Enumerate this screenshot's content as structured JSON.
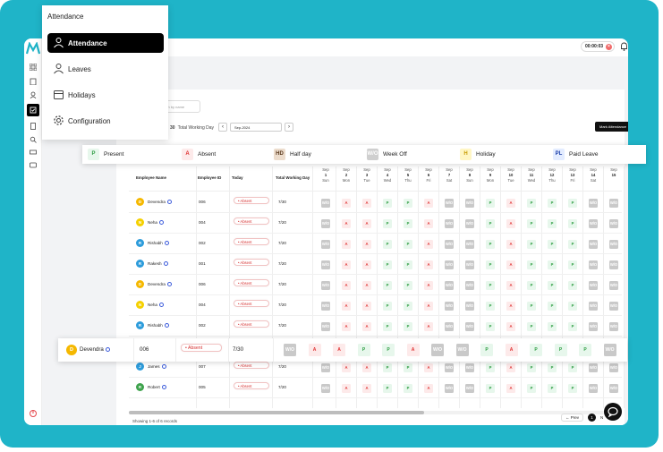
{
  "menu": {
    "title": "Attendance",
    "items": [
      {
        "label": "Attendance",
        "icon": "attendance-icon",
        "active": true
      },
      {
        "label": "Leaves",
        "icon": "leaves-icon",
        "active": false
      },
      {
        "label": "Holidays",
        "icon": "calendar-icon",
        "active": false
      },
      {
        "label": "Configuration",
        "icon": "gear-icon",
        "active": false
      }
    ]
  },
  "header": {
    "timer": "00:00:03"
  },
  "toolbar": {
    "search_placeholder": "Search by name",
    "working_days_count": "30",
    "working_days_label": "Total Working Day",
    "month": "Sep-2024",
    "mark_attendance": "Mark Attendance"
  },
  "legend": [
    {
      "code": "P",
      "label": "Present",
      "bg": "#e7f7ec",
      "fg": "#2f9e44"
    },
    {
      "code": "A",
      "label": "Absent",
      "bg": "#fdeaea",
      "fg": "#e03131"
    },
    {
      "code": "HD",
      "label": "Half day",
      "bg": "#ecdccc",
      "fg": "#5b3a1e"
    },
    {
      "code": "W/O",
      "label": "Week Off",
      "bg": "#cfcfcf",
      "fg": "#ffffff"
    },
    {
      "code": "H",
      "label": "Holiday",
      "bg": "#fff6c4",
      "fg": "#c79a00"
    },
    {
      "code": "PL",
      "label": "Paid Leave",
      "bg": "#e3ecff",
      "fg": "#1c3faa"
    }
  ],
  "table": {
    "columns": {
      "name": "Employee Name",
      "id": "Employee ID",
      "today": "Today",
      "total": "Total Working Day"
    },
    "days": [
      {
        "m": "Sep",
        "d": "1",
        "w": "Sun"
      },
      {
        "m": "Sep",
        "d": "2",
        "w": "Mon"
      },
      {
        "m": "Sep",
        "d": "3",
        "w": "Tue"
      },
      {
        "m": "Sep",
        "d": "4",
        "w": "Wed"
      },
      {
        "m": "Sep",
        "d": "5",
        "w": "Thu"
      },
      {
        "m": "Sep",
        "d": "6",
        "w": "Fri"
      },
      {
        "m": "Sep",
        "d": "7",
        "w": "Sat"
      },
      {
        "m": "Sep",
        "d": "8",
        "w": "Sun"
      },
      {
        "m": "Sep",
        "d": "9",
        "w": "Mon"
      },
      {
        "m": "Sep",
        "d": "10",
        "w": "Tue"
      },
      {
        "m": "Sep",
        "d": "11",
        "w": "Wed"
      },
      {
        "m": "Sep",
        "d": "12",
        "w": "Thu"
      },
      {
        "m": "Sep",
        "d": "13",
        "w": "Fri"
      },
      {
        "m": "Sep",
        "d": "14",
        "w": "Sat"
      },
      {
        "m": "Sep",
        "d": "15",
        "w": ""
      }
    ],
    "rows": [
      {
        "name": "Devendra",
        "initial": "D",
        "color": "#f5b800",
        "id": "006",
        "today": "Absent",
        "total": "7/30",
        "marks": [
          "W/O",
          "A",
          "A",
          "P",
          "P",
          "A",
          "W/O",
          "W/O",
          "P",
          "A",
          "P",
          "P",
          "P",
          "W/O",
          "W/O"
        ]
      },
      {
        "name": "Neha",
        "initial": "N",
        "color": "#f5d000",
        "id": "004",
        "today": "Absent",
        "total": "7/20",
        "marks": [
          "W/O",
          "A",
          "A",
          "P",
          "P",
          "A",
          "W/O",
          "W/O",
          "P",
          "A",
          "P",
          "P",
          "P",
          "W/O",
          "W/O"
        ]
      },
      {
        "name": "Rishabh",
        "initial": "R",
        "color": "#2d9cdb",
        "id": "002",
        "today": "Absent",
        "total": "7/20",
        "marks": [
          "W/O",
          "A",
          "A",
          "P",
          "P",
          "A",
          "W/O",
          "W/O",
          "P",
          "A",
          "P",
          "P",
          "P",
          "W/O",
          "W/O"
        ]
      },
      {
        "name": "Rakesh",
        "initial": "R",
        "color": "#2d9cdb",
        "id": "001",
        "today": "Absent",
        "total": "7/20",
        "marks": [
          "W/O",
          "A",
          "A",
          "P",
          "P",
          "A",
          "W/O",
          "W/O",
          "P",
          "A",
          "P",
          "P",
          "P",
          "W/O",
          "W/O"
        ]
      },
      {
        "name": "Devendra",
        "initial": "D",
        "color": "#f5b800",
        "id": "006",
        "today": "Absent",
        "total": "7/20",
        "marks": [
          "W/O",
          "A",
          "A",
          "P",
          "P",
          "A",
          "W/O",
          "W/O",
          "P",
          "A",
          "P",
          "P",
          "P",
          "W/O",
          "W/O"
        ]
      },
      {
        "name": "Neha",
        "initial": "N",
        "color": "#f5d000",
        "id": "004",
        "today": "Absent",
        "total": "7/20",
        "marks": [
          "W/O",
          "A",
          "A",
          "P",
          "P",
          "A",
          "W/O",
          "W/O",
          "P",
          "A",
          "P",
          "P",
          "P",
          "W/O",
          "W/O"
        ]
      },
      {
        "name": "Rishabh",
        "initial": "R",
        "color": "#2d9cdb",
        "id": "002",
        "today": "Absent",
        "total": "7/20",
        "marks": [
          "W/O",
          "A",
          "A",
          "P",
          "P",
          "A",
          "W/O",
          "W/O",
          "P",
          "A",
          "P",
          "P",
          "P",
          "W/O",
          "W/O"
        ]
      },
      {
        "name": "Devendra",
        "initial": "D",
        "color": "#f5b800",
        "id": "006",
        "today": "Absent",
        "total": "7/20",
        "marks": [
          "W/O",
          "A",
          "A",
          "P",
          "P",
          "A",
          "W/O",
          "W/O",
          "P",
          "A",
          "P",
          "P",
          "P",
          "W/O",
          "W/O"
        ]
      },
      {
        "name": "James",
        "initial": "J",
        "color": "#2d9cdb",
        "id": "007",
        "today": "Absent",
        "total": "7/20",
        "marks": [
          "W/O",
          "A",
          "A",
          "P",
          "P",
          "A",
          "W/O",
          "W/O",
          "P",
          "A",
          "P",
          "P",
          "P",
          "W/O",
          "W/O"
        ]
      },
      {
        "name": "Robert",
        "initial": "R",
        "color": "#3fa34d",
        "id": "005",
        "today": "Absent",
        "total": "7/20",
        "marks": [
          "W/O",
          "A",
          "A",
          "P",
          "P",
          "A",
          "W/O",
          "W/O",
          "P",
          "A",
          "P",
          "P",
          "P",
          "W/O",
          "W/O"
        ]
      }
    ],
    "highlight": {
      "name": "Devendra",
      "initial": "D",
      "color": "#f5b800",
      "id": "006",
      "today": "Absent",
      "total": "7/30",
      "marks": [
        "W/O",
        "A",
        "A",
        "P",
        "P",
        "A",
        "W/O",
        "W/O",
        "P",
        "A",
        "P",
        "P",
        "P",
        "W/O"
      ]
    }
  },
  "footer": {
    "records": "Showing 1-6 of 6 records",
    "prev": "Prev",
    "page": "1",
    "next": "N"
  }
}
